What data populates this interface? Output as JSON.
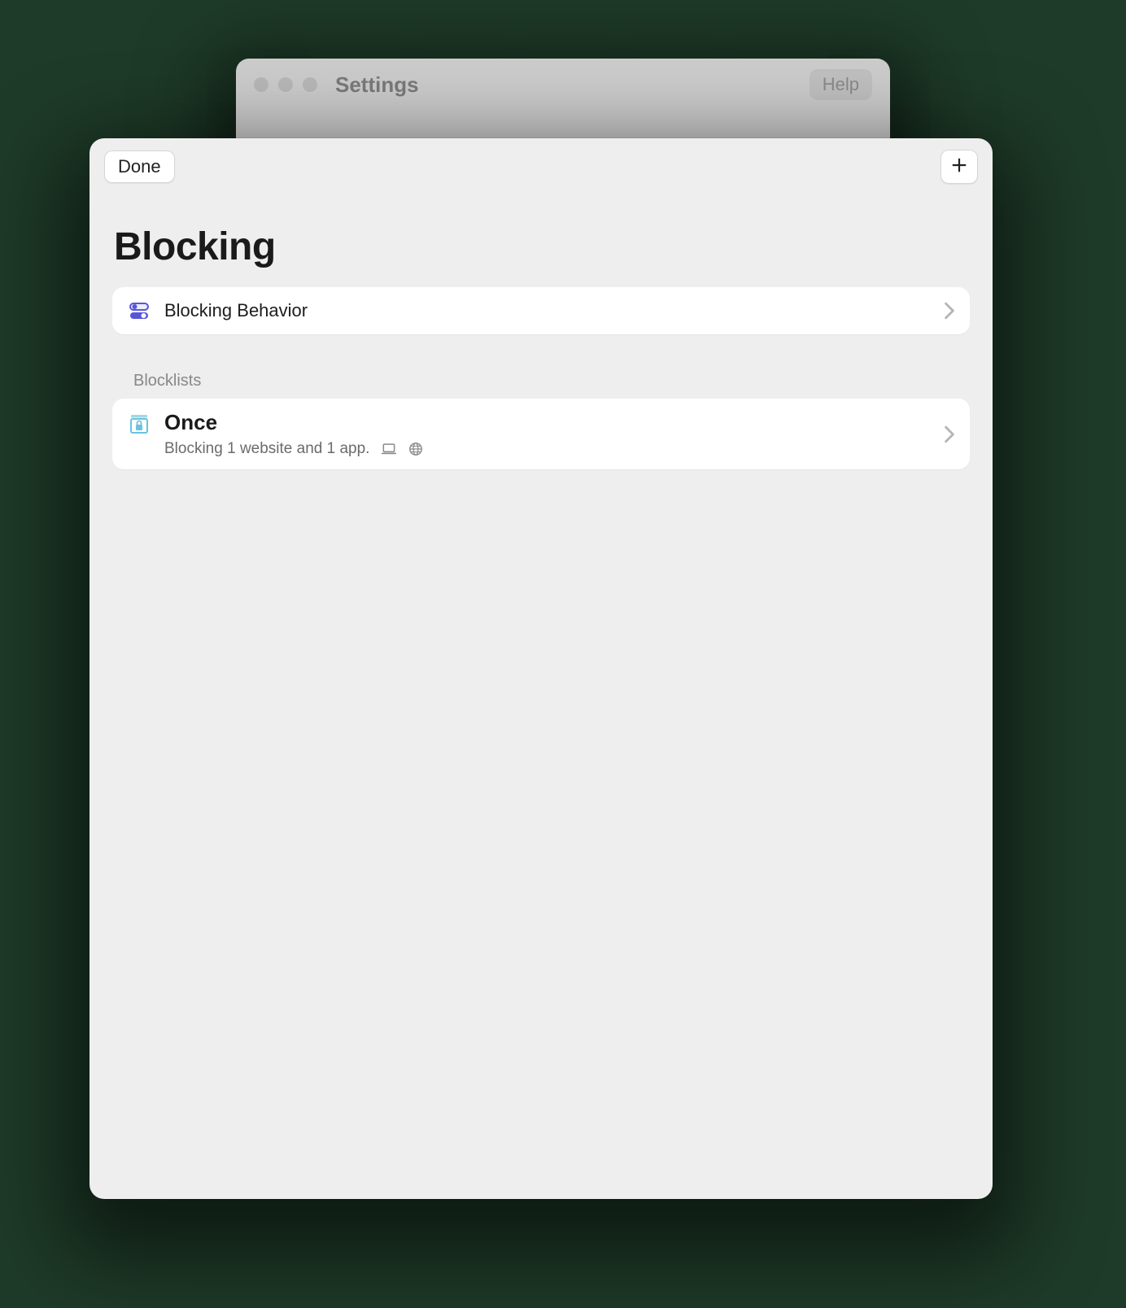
{
  "parent_window": {
    "title": "Settings",
    "help_label": "Help"
  },
  "sheet": {
    "done_label": "Done",
    "page_title": "Blocking",
    "blocking_behavior_label": "Blocking Behavior",
    "blocklists_section_label": "Blocklists",
    "blocklists": [
      {
        "name": "Once",
        "subtitle": "Blocking 1 website and 1 app."
      }
    ]
  },
  "colors": {
    "accent_indigo": "#5856d6",
    "accent_cyan": "#6cc2e0"
  }
}
